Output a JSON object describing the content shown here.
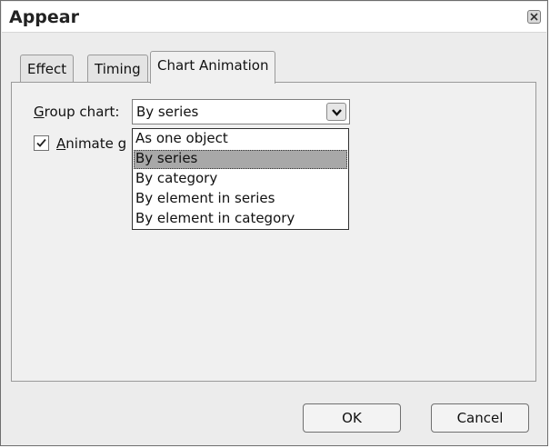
{
  "dialog": {
    "title": "Appear"
  },
  "tabs": [
    {
      "label": "Effect"
    },
    {
      "label": "Timing"
    },
    {
      "label": "Chart Animation",
      "active": true
    }
  ],
  "group_chart": {
    "label_accel": "G",
    "label_rest": "roup chart:",
    "selected": "By series",
    "options": [
      "As one object",
      "By series",
      "By category",
      "By element in series",
      "By element in category"
    ]
  },
  "animate_grid": {
    "checked": true,
    "label_accel": "A",
    "label_rest": "nimate g"
  },
  "buttons": {
    "ok": "OK",
    "cancel": "Cancel"
  },
  "colors": {
    "selected_option": "#a8a8a8",
    "dialog_bg": "#ececec"
  }
}
